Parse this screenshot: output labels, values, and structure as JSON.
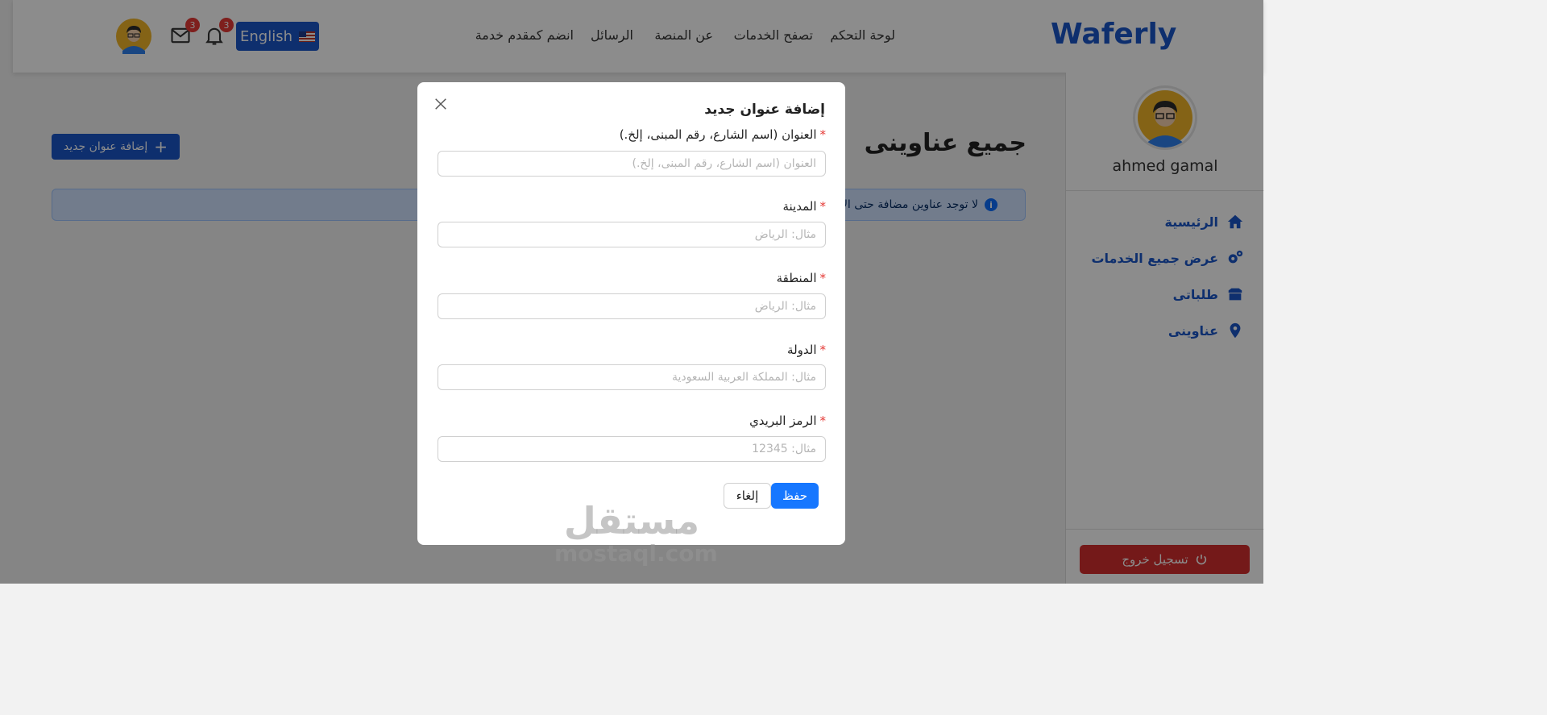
{
  "header": {
    "logo": "Waferly",
    "nav": [
      "لوحة التحكم",
      "تصفح الخدمات",
      "عن المنصة",
      "الرسائل",
      "انضم كمقدم خدمة"
    ],
    "language_label": "English",
    "messages_count": "3",
    "notifications_count": "3"
  },
  "sidebar": {
    "user_name": "ahmed gamal",
    "items": [
      {
        "label": "الرئيسية",
        "icon": "home-icon"
      },
      {
        "label": "عرض جميع الخدمات",
        "icon": "gears-icon"
      },
      {
        "label": "طلباتى",
        "icon": "box-icon"
      },
      {
        "label": "عناوينى",
        "icon": "map-pin-icon"
      }
    ],
    "logout_label": "تسجيل خروج"
  },
  "main": {
    "title": "جميع عناوينى",
    "add_button_label": "إضافة عنوان جديد",
    "info_message": "لا توجد عناوين مضافة حتى الآن"
  },
  "modal": {
    "title": "إضافة عنوان جديد",
    "fields": [
      {
        "label": "العنوان (اسم الشارع، رقم المبنى، إلخ.)",
        "placeholder": "العنوان (اسم الشارع، رقم المبنى، إلخ.)",
        "value": "",
        "required": true
      },
      {
        "label": "المدينة",
        "placeholder": "مثال: الرياض",
        "value": "",
        "required": true
      },
      {
        "label": "المنطقة",
        "placeholder": "مثال: الرياض",
        "value": "",
        "required": true
      },
      {
        "label": "الدولة",
        "placeholder": "مثال: المملكة العربية السعودية",
        "value": "",
        "required": true
      },
      {
        "label": "الرمز البريدي",
        "placeholder": "مثال: 12345",
        "value": "",
        "required": true
      }
    ],
    "save_label": "حفظ",
    "cancel_label": "إلغاء"
  },
  "watermark": {
    "arabic": "مستقل",
    "latin": "mostaql.com"
  },
  "colors": {
    "primary": "#1a56c8",
    "danger": "#d32f2f",
    "modal_primary": "#1677ff",
    "required_star": "#e53935",
    "info_bg": "#cfe2ff"
  }
}
